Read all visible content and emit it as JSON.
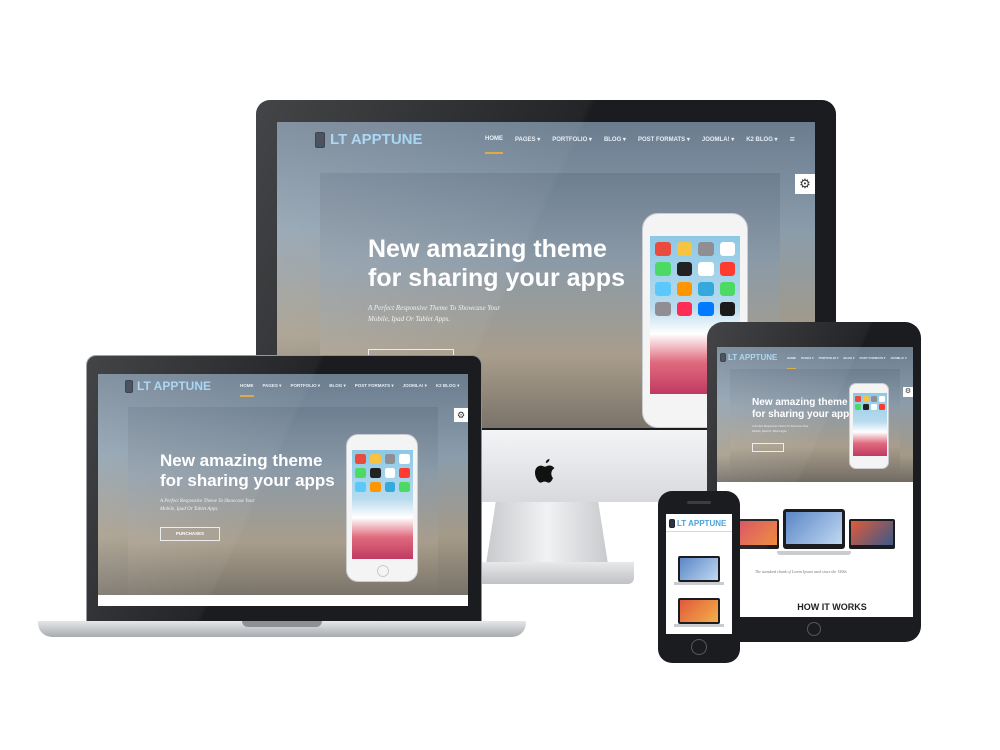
{
  "brand": {
    "name": "LT APPTUNE",
    "accent": "#9fd2f2",
    "nav_active": "#d9a53a"
  },
  "nav": {
    "items": [
      "HOME",
      "PAGES ▾",
      "PORTFOLIO ▾",
      "BLOG ▾",
      "POST FORMATS ▾",
      "JOOMLA! ▾",
      "K2 BLOG ▾"
    ],
    "menu_icon": "≡"
  },
  "hero": {
    "title": "New amazing theme\nfor sharing your apps",
    "subtitle": "A Perfect Responsive Theme To Showcase Your\nMobile, Ipad Or Tablet Apps.",
    "button": "PURCHASES",
    "settings_icon": "⚙"
  },
  "tablet": {
    "caption": "The standard chunk of Lorem Ipsum used since the 1500s",
    "section_title": "HOW IT WORKS"
  },
  "icons": [
    "gear-icon",
    "apple-logo-icon",
    "phone-icon",
    "menu-icon"
  ]
}
